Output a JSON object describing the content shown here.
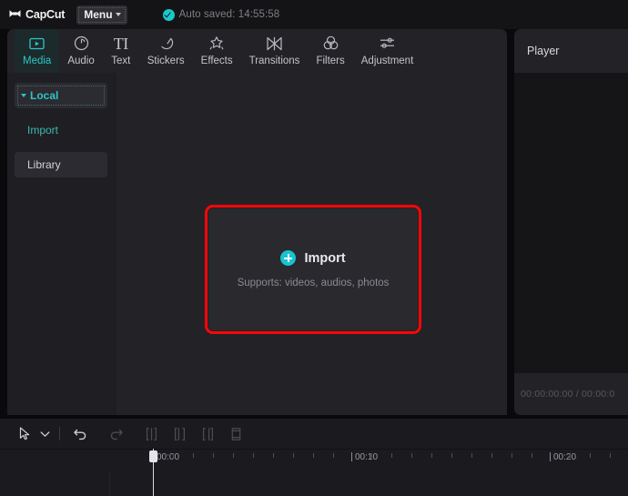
{
  "titlebar": {
    "brand": "CapCut",
    "brand_icon": "capcut-logo-icon",
    "menu_label": "Menu",
    "autosave_text": "Auto saved: 14:55:58",
    "autosave_icon": "check-circle-icon"
  },
  "tabs": [
    {
      "label": "Media",
      "icon": "media-play-rect-icon",
      "active": true
    },
    {
      "label": "Audio",
      "icon": "audio-note-icon",
      "active": false
    },
    {
      "label": "Text",
      "icon": "text-TI-icon",
      "active": false
    },
    {
      "label": "Stickers",
      "icon": "sticker-moon-icon",
      "active": false
    },
    {
      "label": "Effects",
      "icon": "effects-sparkle-icon",
      "active": false
    },
    {
      "label": "Transitions",
      "icon": "transitions-bowtie-icon",
      "active": false
    },
    {
      "label": "Filters",
      "icon": "filters-circles-icon",
      "active": false
    },
    {
      "label": "Adjustment",
      "icon": "adjustment-sliders-icon",
      "active": false
    }
  ],
  "sidebar": {
    "items": [
      {
        "label": "Local",
        "state": "selected"
      },
      {
        "label": "Import",
        "state": "link"
      },
      {
        "label": "Library",
        "state": "hover"
      }
    ]
  },
  "dropzone": {
    "title": "Import",
    "subtitle": "Supports: videos, audios, photos",
    "plus_icon": "plus-circle-icon",
    "highlight_color": "#fc0606"
  },
  "player": {
    "title": "Player",
    "timecode": "00:00:00:00 / 00:00:0"
  },
  "timeline": {
    "tools": [
      {
        "name": "select-arrow-tool",
        "icon": "cursor-arrow-icon",
        "state": "active"
      },
      {
        "name": "tool-dropdown",
        "icon": "chevron-down-icon",
        "state": "active"
      },
      {
        "name": "undo-button",
        "icon": "undo-arrow-icon",
        "state": "active"
      },
      {
        "name": "redo-button",
        "icon": "redo-arrow-icon",
        "state": "disabled"
      },
      {
        "name": "split-button",
        "icon": "split-clip-icon",
        "state": "disabled"
      },
      {
        "name": "trim-left-button",
        "icon": "trim-left-icon",
        "state": "disabled"
      },
      {
        "name": "trim-right-button",
        "icon": "trim-right-icon",
        "state": "disabled"
      },
      {
        "name": "delete-button",
        "icon": "delete-clip-icon",
        "state": "disabled"
      }
    ],
    "ruler_labels": [
      "00:00",
      "00:10",
      "00:20"
    ],
    "playhead_position": "00:00"
  },
  "colors": {
    "accent_teal": "#2ec5c5",
    "cyan": "#19c2cf",
    "highlight_red": "#fc0606",
    "panel_bg": "#232327",
    "app_bg": "#0a0a0c"
  }
}
